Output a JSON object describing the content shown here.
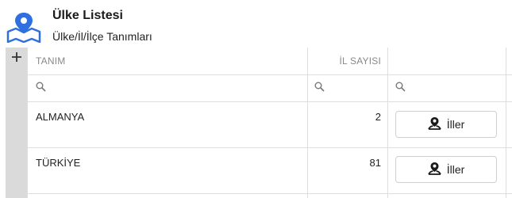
{
  "header": {
    "title": "Ülke Listesi",
    "subtitle": "Ülke/İl/İlçe Tanımları",
    "icon": "map-pin-icon",
    "accent_color": "#2f6fe0"
  },
  "grid": {
    "columns": [
      {
        "key": "tanim",
        "label": "TANIM"
      },
      {
        "key": "il_sayisi",
        "label": "İL SAYISI"
      },
      {
        "key": "action",
        "label": ""
      }
    ],
    "filter_icon": "search-icon",
    "add_icon": "plus-icon",
    "rows": [
      {
        "tanim": "ALMANYA",
        "il_sayisi": "2",
        "button_label": "İller"
      },
      {
        "tanim": "TÜRKİYE",
        "il_sayisi": "81",
        "button_label": "İller"
      }
    ],
    "row_button_icon": "map-marker-person-icon"
  }
}
